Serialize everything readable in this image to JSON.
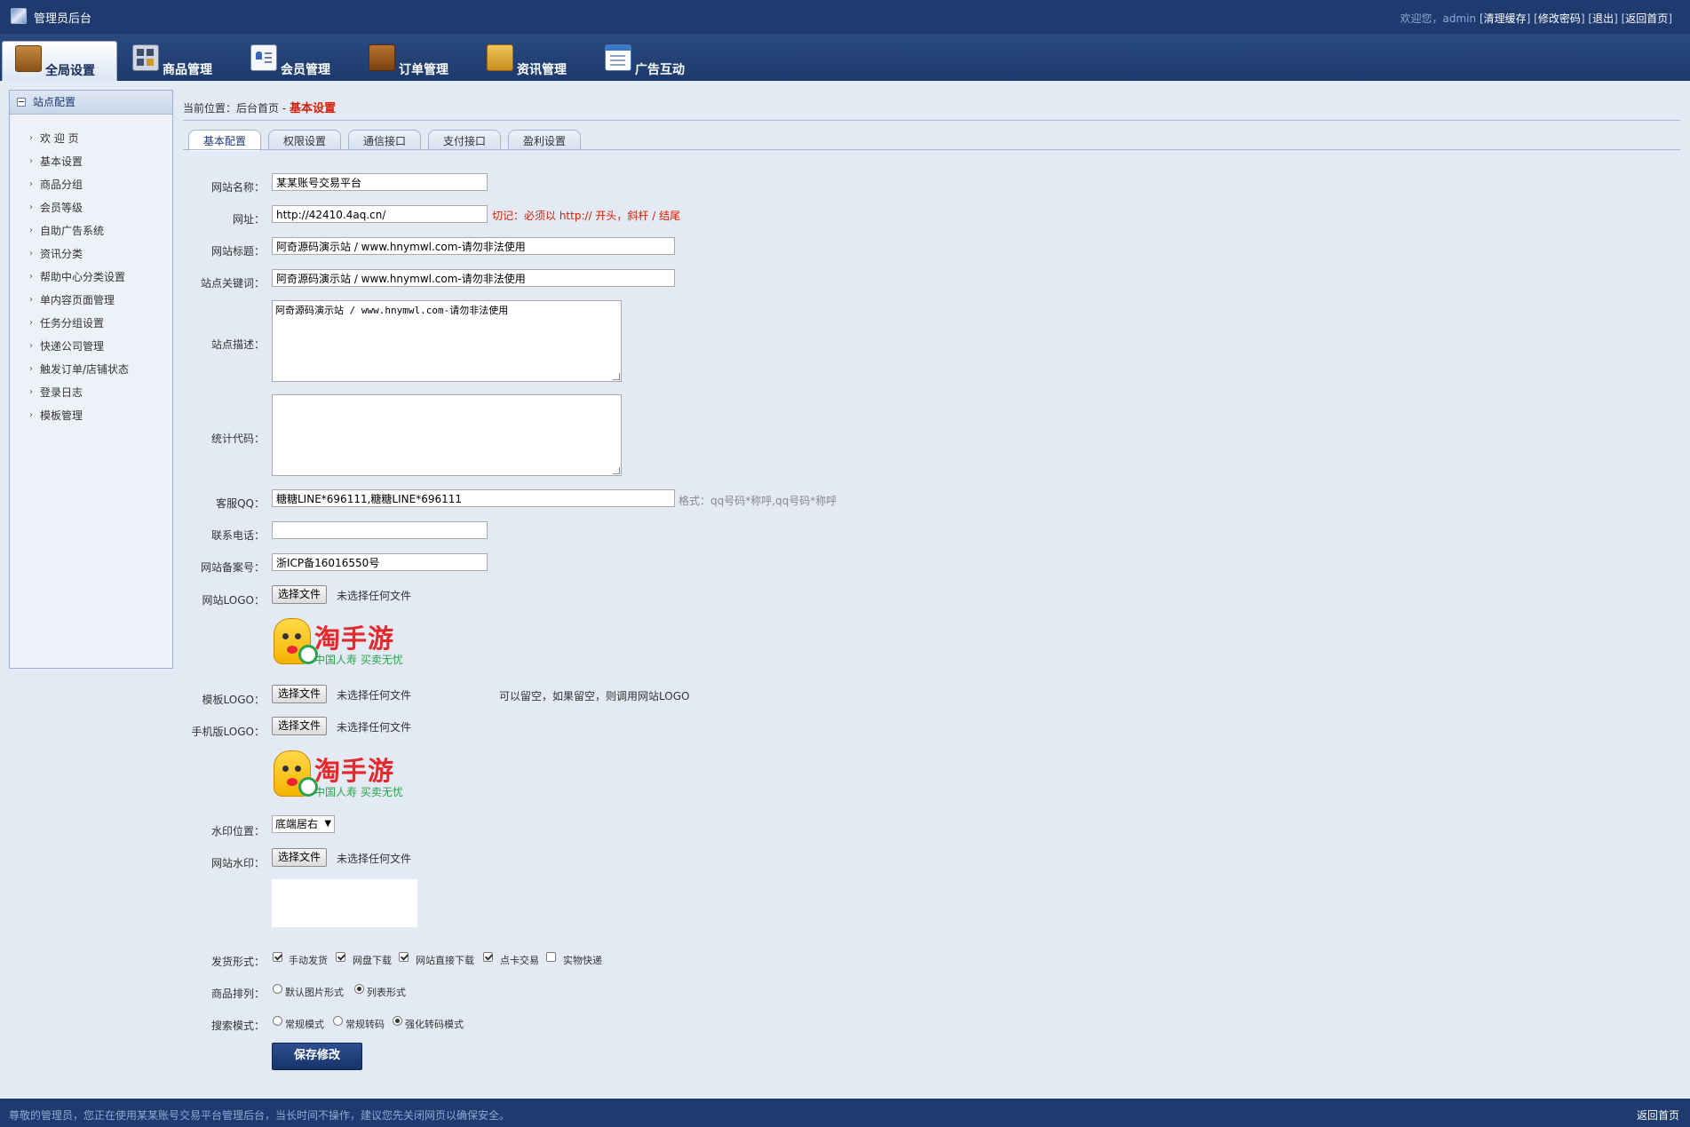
{
  "header": {
    "app_title": "管理员后台",
    "welcome_prefix": "欢迎您，admin",
    "links": [
      "清理缓存",
      "修改密码",
      "退出",
      "返回首页"
    ]
  },
  "nav": {
    "tabs": [
      {
        "label": "全局设置",
        "icon": "box-icon"
      },
      {
        "label": "商品管理",
        "icon": "grid-icon"
      },
      {
        "label": "会员管理",
        "icon": "member-card-icon"
      },
      {
        "label": "订单管理",
        "icon": "wallet-icon"
      },
      {
        "label": "资讯管理",
        "icon": "folder-icon"
      },
      {
        "label": "广告互动",
        "icon": "document-icon"
      }
    ]
  },
  "sidebar": {
    "header": "站点配置",
    "items": [
      "欢 迎 页",
      "基本设置",
      "商品分组",
      "会员等级",
      "自助广告系统",
      "资讯分类",
      "帮助中心分类设置",
      "单内容页面管理",
      "任务分组设置",
      "快递公司管理",
      "触发订单/店铺状态",
      "登录日志",
      "模板管理"
    ]
  },
  "breadcrumb": {
    "prefix": "当前位置：",
    "home": "后台首页",
    "sep": "-",
    "current": "基本设置"
  },
  "subtabs": [
    "基本配置",
    "权限设置",
    "通信接口",
    "支付接口",
    "盈利设置"
  ],
  "form": {
    "site_name": {
      "label": "网站名称：",
      "value": "某某账号交易平台"
    },
    "site_url": {
      "label": "网址：",
      "value": "http://42410.4aq.cn/",
      "hint": "切记：必须以 http:// 开头，斜杆 / 结尾"
    },
    "site_title": {
      "label": "网站标题：",
      "value": "阿奇源码演示站 / www.hnymwl.com-请勿非法使用"
    },
    "keywords": {
      "label": "站点关键词：",
      "value": "阿奇源码演示站 / www.hnymwl.com-请勿非法使用"
    },
    "description": {
      "label": "站点描述：",
      "value": "阿奇源码演示站 / www.hnymwl.com-请勿非法使用"
    },
    "stats_code": {
      "label": "统计代码：",
      "value": ""
    },
    "qq": {
      "label": "客服QQ：",
      "value": "糖糖LINE*696111,糖糖LINE*696111",
      "hint": "格式：qq号码*称呼,qq号码*称呼"
    },
    "phone": {
      "label": "联系电话：",
      "value": ""
    },
    "icp": {
      "label": "网站备案号：",
      "value": "浙ICP备16016550号"
    },
    "site_logo": {
      "label": "网站LOGO：",
      "button": "选择文件",
      "status": "未选择任何文件"
    },
    "template_logo": {
      "label": "模板LOGO：",
      "button": "选择文件",
      "status": "未选择任何文件",
      "hint": "可以留空，如果留空，则调用网站LOGO"
    },
    "mobile_logo": {
      "label": "手机版LOGO：",
      "button": "选择文件",
      "status": "未选择任何文件"
    },
    "logo_image": {
      "brand": "淘手游",
      "slogan": "中国人寿 买卖无忧"
    },
    "watermark_pos": {
      "label": "水印位置：",
      "value": "底端居右"
    },
    "watermark": {
      "label": "网站水印：",
      "button": "选择文件",
      "status": "未选择任何文件"
    },
    "delivery": {
      "label": "发货形式：",
      "options": [
        {
          "label": "手动发货",
          "checked": true
        },
        {
          "label": "网盘下载",
          "checked": true
        },
        {
          "label": "网站直接下载",
          "checked": true
        },
        {
          "label": "点卡交易",
          "checked": true
        },
        {
          "label": "实物快递",
          "checked": false
        }
      ]
    },
    "sort": {
      "label": "商品排列：",
      "options": [
        {
          "label": "默认图片形式",
          "checked": false
        },
        {
          "label": "列表形式",
          "checked": true
        }
      ]
    },
    "search": {
      "label": "搜索模式：",
      "options": [
        {
          "label": "常规模式",
          "checked": false
        },
        {
          "label": "常规转码",
          "checked": false
        },
        {
          "label": "强化转码模式",
          "checked": true
        }
      ]
    },
    "save_label": "保存修改"
  },
  "footer": {
    "message": "尊敬的管理员，您正在使用某某账号交易平台管理后台，当长时间不操作，建议您先关闭网页以确保安全。",
    "back_label": "返回首页"
  },
  "colors": {
    "header_bg": "#1e3a6e",
    "accent_red": "#d81e06",
    "page_bg": "#e4eaf3"
  }
}
